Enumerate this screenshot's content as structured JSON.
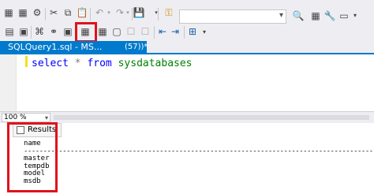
{
  "toolbar_top": {
    "icons": [
      "execute-mdx-icon",
      "execute-dmx-icon",
      "execute-xmla-icon",
      "cut-icon",
      "copy-icon",
      "paste-icon",
      "undo-icon",
      "redo-icon",
      "save-icon",
      "find-icon"
    ],
    "combo_value": ""
  },
  "toolbar_bottom": {
    "icons": [
      "database-icon",
      "parse-icon",
      "results-to-grid-icon",
      "results-to-text-icon",
      "results-to-file-icon",
      "comment-icon",
      "uncomment-icon",
      "indent-icon",
      "outdent-icon",
      "specify-values-icon"
    ]
  },
  "tab": {
    "label": "SQLQuery1.sql - MS...",
    "label_suffix": "(57))*"
  },
  "editor": {
    "line": [
      "select",
      "*",
      "from",
      "sysdatabases"
    ]
  },
  "zoom": {
    "value": "100 %"
  },
  "results": {
    "tab_label": "Results",
    "column": "name",
    "separator": "----------------------------------------------------------------------------------------------------------------------------------",
    "rows": [
      "master",
      "tempdb",
      "model",
      "msdb"
    ]
  },
  "highlight_color": "#e0121b",
  "accent_color": "#007acc"
}
